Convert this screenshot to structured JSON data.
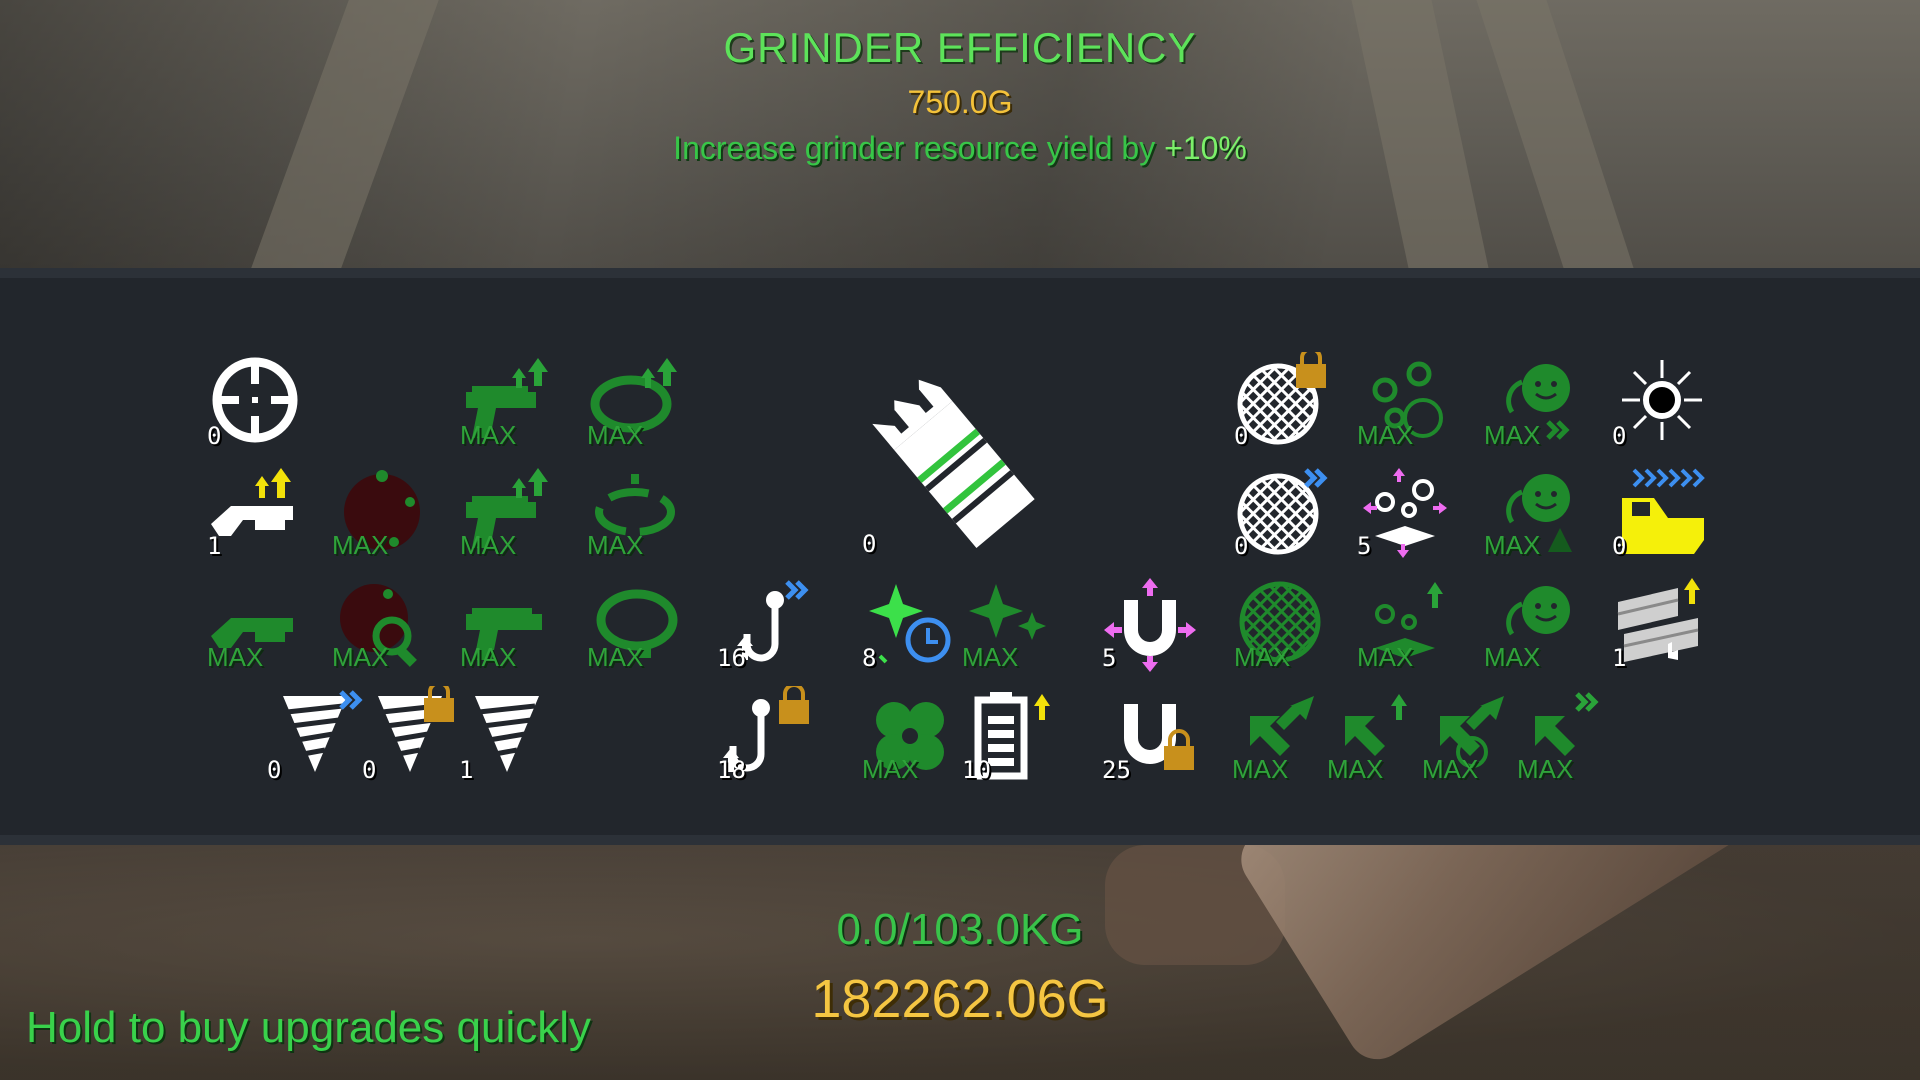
{
  "header": {
    "title": "GRINDER EFFICIENCY",
    "cost": "750.0G",
    "description_prefix": "Increase grinder resource yield by ",
    "description_value": "+10%"
  },
  "upgrades": {
    "crosshair": "0",
    "pistol_damage": "MAX",
    "whip_upgrade": "MAX",
    "shotgun": "1",
    "bomb": "MAX",
    "pistol_rate": "MAX",
    "whip_range": "MAX",
    "shotgun_green": "MAX",
    "bomb_scan": "MAX",
    "pistol_basic": "MAX",
    "whip_basic": "MAX",
    "grinder_main": "0",
    "hook_speed": "16",
    "sparkle_timer": "8",
    "sparkle": "MAX",
    "drill_speed": "0",
    "drill_lock": "0",
    "drill": "1",
    "hook_lock": "18",
    "clover": "MAX",
    "battery": "10",
    "net_lock": "0",
    "bubbles_timer": "MAX",
    "sun_gear": "MAX",
    "sunburst": "0",
    "net_speed": "0",
    "bubbles_spread": "5",
    "sun_gear_plant": "MAX",
    "cart": "0",
    "magnet_spread": "5",
    "net_green": "MAX",
    "bubbles_up": "MAX",
    "sun_gear_plain": "MAX",
    "bricks": "1",
    "magnet_lock": "25",
    "recycle_1": "MAX",
    "recycle_2": "MAX",
    "recycle_3": "MAX",
    "recycle_4": "MAX"
  },
  "footer": {
    "capacity": "0.0/103.0KG",
    "money": "182262.06G",
    "hint": "Hold to buy upgrades quickly"
  },
  "colors": {
    "title_green": "#5de35a",
    "gold": "#f4c23a",
    "max_green": "#2fa33a",
    "panel_bg": "#22262c"
  }
}
